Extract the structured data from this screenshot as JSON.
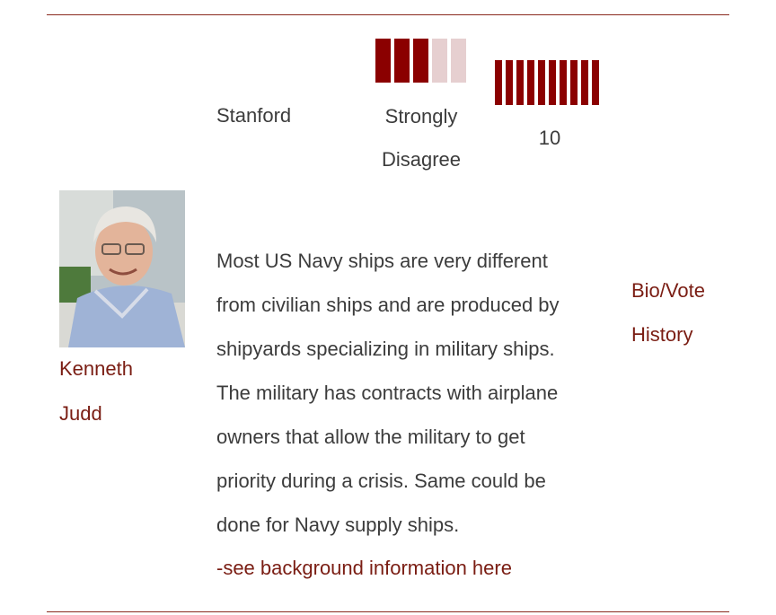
{
  "colors": {
    "accent": "#7a1d13",
    "bar_on": "#8b0000",
    "bar_off": "#e6cfd0",
    "rule": "#8a2a1e",
    "text": "#3c3c3c"
  },
  "participant": {
    "name_first": "Kenneth",
    "name_last": "Judd",
    "school": "Stanford",
    "photo_icon": "person-photo"
  },
  "vote": {
    "label_line1": "Strongly",
    "label_line2": "Disagree",
    "bar_level": 3,
    "bar_max": 5
  },
  "confidence": {
    "value": "10",
    "bar_level": 10,
    "bar_max": 10
  },
  "comment": {
    "lines": [
      "Most US Navy ships are very different",
      "from civilian ships and are produced by",
      "shipyards specializing in military ships.",
      "The military has contracts with airplane",
      "owners that allow the military to get",
      "priority during a crisis. Same could be",
      "done for Navy supply ships."
    ],
    "background_link": "-see background information here"
  },
  "bio_link": {
    "line1": "Bio/Vote",
    "line2": "History"
  }
}
